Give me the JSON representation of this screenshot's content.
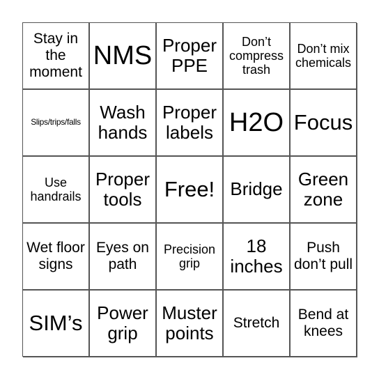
{
  "board": {
    "cells": [
      {
        "text": "Stay in the moment",
        "size": "m"
      },
      {
        "text": "NMS",
        "size": "xxl"
      },
      {
        "text": "Proper PPE",
        "size": "l"
      },
      {
        "text": "Don’t compress trash",
        "size": "s"
      },
      {
        "text": "Don’t mix chemicals",
        "size": "s"
      },
      {
        "text": "Slips/trips/falls",
        "size": "xs"
      },
      {
        "text": "Wash hands",
        "size": "l"
      },
      {
        "text": "Proper labels",
        "size": "l"
      },
      {
        "text": "H2O",
        "size": "xxl"
      },
      {
        "text": "Focus",
        "size": "xl"
      },
      {
        "text": "Use handrails",
        "size": "s"
      },
      {
        "text": "Proper tools",
        "size": "l"
      },
      {
        "text": "Free!",
        "size": "xl"
      },
      {
        "text": "Bridge",
        "size": "l"
      },
      {
        "text": "Green zone",
        "size": "l"
      },
      {
        "text": "Wet floor signs",
        "size": "m"
      },
      {
        "text": "Eyes on path",
        "size": "m"
      },
      {
        "text": "Precision grip",
        "size": "s"
      },
      {
        "text": "18 inches",
        "size": "l"
      },
      {
        "text": "Push don’t pull",
        "size": "m"
      },
      {
        "text": "SIM’s",
        "size": "xl"
      },
      {
        "text": "Power grip",
        "size": "l"
      },
      {
        "text": "Muster points",
        "size": "l"
      },
      {
        "text": "Stretch",
        "size": "m"
      },
      {
        "text": "Bend at knees",
        "size": "m"
      }
    ]
  }
}
